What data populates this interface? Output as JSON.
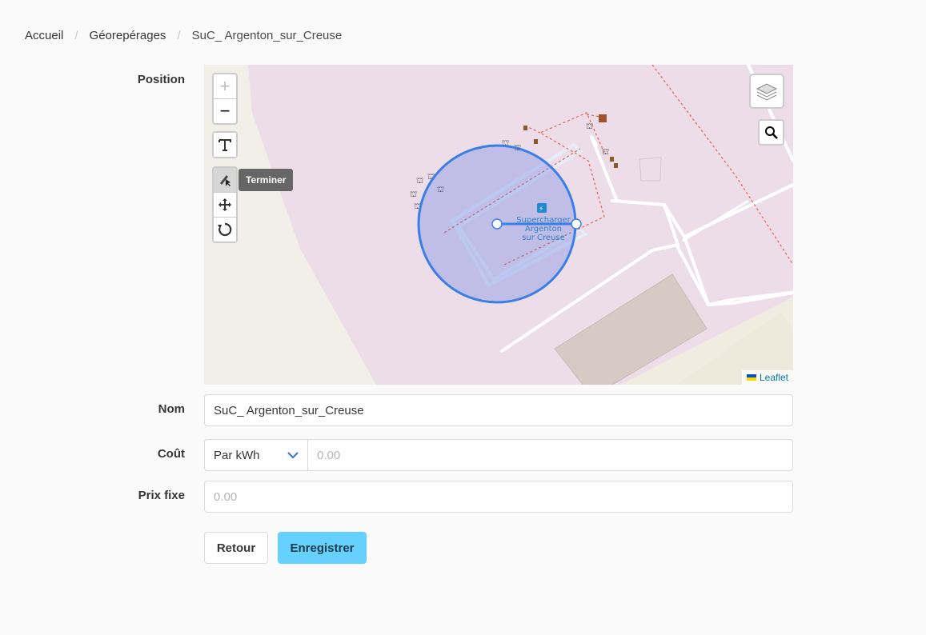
{
  "breadcrumb": {
    "home": "Accueil",
    "section": "Géorepérages",
    "current": "SuC_ Argenton_sur_Creuse"
  },
  "form": {
    "position_label": "Position",
    "name_label": "Nom",
    "name_value": "SuC_ Argenton_sur_Creuse",
    "cost_label": "Coût",
    "cost_unit": "Par kWh",
    "cost_placeholder": "0.00",
    "fixed_price_label": "Prix fixe",
    "fixed_price_placeholder": "0.00"
  },
  "map": {
    "zoom_in": "+",
    "zoom_out": "−",
    "tooltip": "Terminer",
    "poi_label_1": "Supercharger",
    "poi_label_2": "Argenton",
    "poi_label_3": "sur Creuse",
    "attribution": "Leaflet",
    "colors": {
      "circle": "#3a7fe6",
      "background": "#ecdde8",
      "building": "#d7cac5"
    }
  },
  "buttons": {
    "back": "Retour",
    "save": "Enregistrer"
  }
}
